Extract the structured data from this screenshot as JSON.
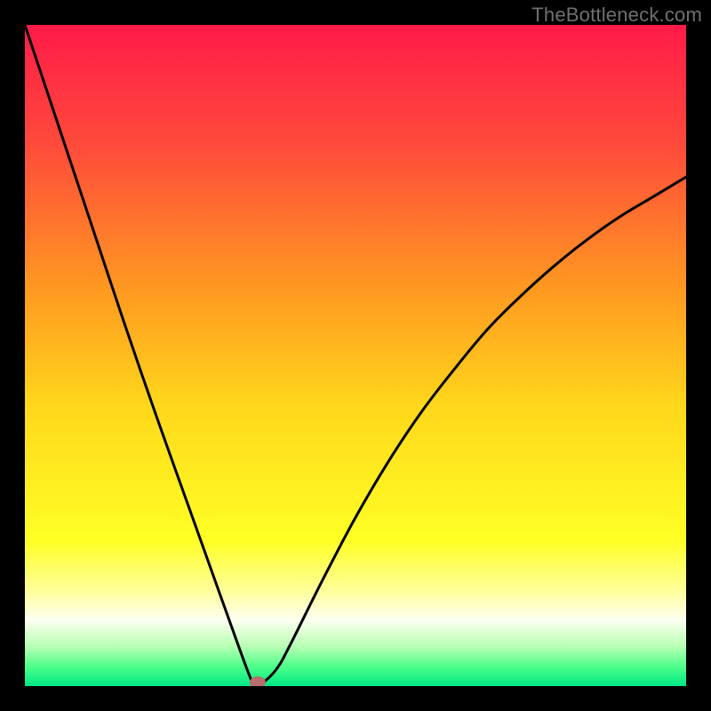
{
  "watermark": "TheBottleneck.com",
  "chart_data": {
    "type": "line",
    "title": "",
    "xlabel": "",
    "ylabel": "",
    "xlim": [
      0,
      100
    ],
    "ylim": [
      0,
      100
    ],
    "grid": false,
    "legend": false,
    "series": [
      {
        "name": "bottleneck-curve",
        "x": [
          0,
          5,
          10,
          15,
          20,
          25,
          30,
          34,
          35,
          36,
          38,
          40,
          45,
          50,
          55,
          60,
          65,
          70,
          75,
          80,
          85,
          90,
          95,
          100
        ],
        "values": [
          100,
          85.0,
          70.0,
          55.0,
          40.5,
          26.5,
          12.5,
          1.5,
          0.0,
          0.5,
          2.5,
          6.0,
          16.0,
          25.5,
          34.0,
          41.5,
          48.0,
          54.0,
          59.0,
          63.5,
          67.5,
          71.0,
          74.0,
          77.0
        ]
      }
    ],
    "marker": {
      "name": "ideal-point",
      "x": 35.2,
      "y": 0,
      "color": "#b96d6e"
    },
    "background_gradient": {
      "type": "vertical",
      "stops": [
        {
          "pos": 0.0,
          "color": "#ff1b49"
        },
        {
          "pos": 0.18,
          "color": "#ff4a3b"
        },
        {
          "pos": 0.4,
          "color": "#ff9921"
        },
        {
          "pos": 0.58,
          "color": "#ffd81b"
        },
        {
          "pos": 0.78,
          "color": "#ffff25"
        },
        {
          "pos": 0.86,
          "color": "#ffffa2"
        },
        {
          "pos": 0.9,
          "color": "#fdfff1"
        },
        {
          "pos": 0.94,
          "color": "#b8ffb4"
        },
        {
          "pos": 0.97,
          "color": "#4fff8a"
        },
        {
          "pos": 1.0,
          "color": "#00e884"
        }
      ]
    }
  }
}
